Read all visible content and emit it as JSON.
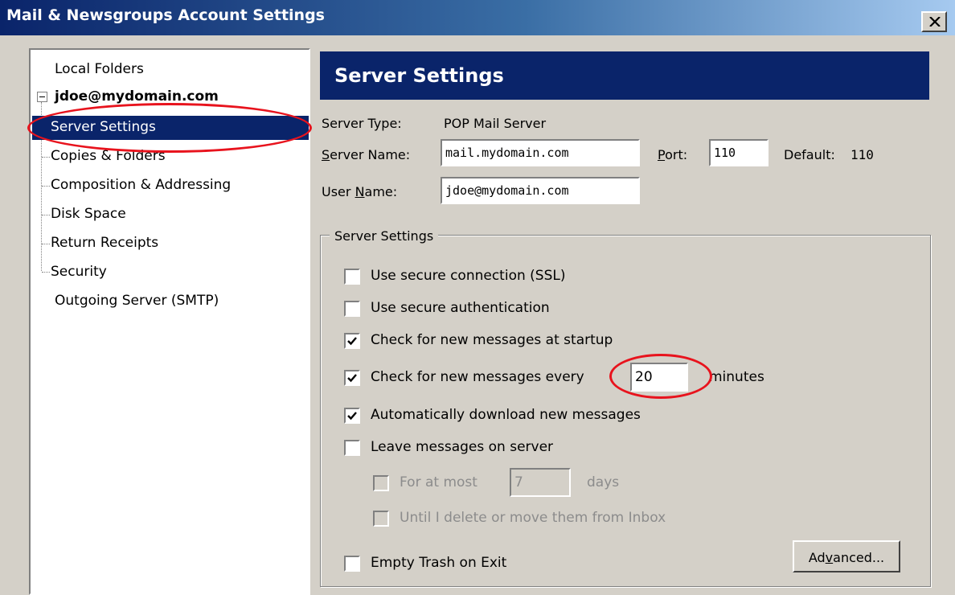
{
  "window": {
    "title": "Mail & Newsgroups Account Settings"
  },
  "tree": {
    "local_folders": "Local Folders",
    "account": "jdoe@mydomain.com",
    "children": [
      "Server Settings",
      "Copies & Folders",
      "Composition & Addressing",
      "Disk Space",
      "Return Receipts",
      "Security"
    ],
    "outgoing": "Outgoing Server (SMTP)",
    "selected": "Server Settings"
  },
  "panel": {
    "title": "Server Settings",
    "server_type_label": "Server Type:",
    "server_type_value": "POP Mail Server",
    "server_name_label_pre": "",
    "server_name_label_accel": "S",
    "server_name_label_post": "erver Name:",
    "server_name_value": "mail.mydomain.com",
    "port_label_accel": "P",
    "port_label_post": "ort:",
    "port_value": "110",
    "default_label": "Default:",
    "default_value": "110",
    "user_name_label_pre": "User ",
    "user_name_label_accel": "N",
    "user_name_label_post": "ame:",
    "user_name_value": "jdoe@mydomain.com"
  },
  "group": {
    "legend": "Server Settings",
    "ssl": {
      "label": "Use secure connection (SSL)",
      "checked": false
    },
    "secure_auth": {
      "label": "Use secure authentication",
      "checked": false
    },
    "check_startup": {
      "label": "Check for new messages at startup",
      "checked": true
    },
    "check_every": {
      "label": "Check for new messages every",
      "checked": true,
      "minutes": "20",
      "suffix": "minutes"
    },
    "auto_download": {
      "label": "Automatically download new messages",
      "checked": true
    },
    "leave_on_server": {
      "label": "Leave messages on server",
      "checked": false
    },
    "for_at_most": {
      "label": "For at most",
      "checked": false,
      "days_value": "7",
      "days_label": "days"
    },
    "until_delete": {
      "label": "Until I delete or move them from Inbox",
      "checked": false
    },
    "empty_trash": {
      "label": "Empty Trash on Exit",
      "checked": false
    },
    "advanced_pre": "Ad",
    "advanced_accel": "v",
    "advanced_post": "anced..."
  },
  "colors": {
    "selection": "#0a246a",
    "annotation": "#e8131d",
    "dialog": "#d4d0c8"
  }
}
